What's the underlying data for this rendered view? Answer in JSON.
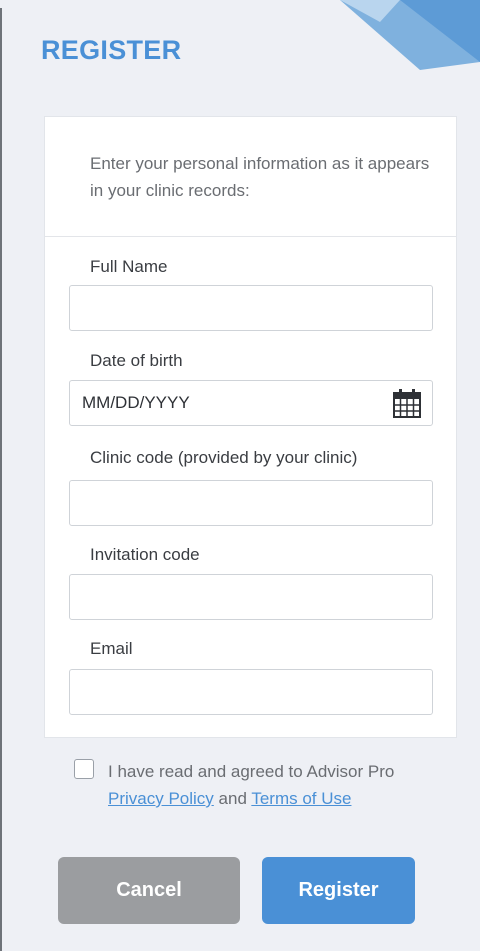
{
  "header": {
    "title": "REGISTER"
  },
  "intro": {
    "text": "Enter your personal information as it appears in your clinic records:"
  },
  "form": {
    "full_name": {
      "label": "Full Name",
      "value": "",
      "placeholder": ""
    },
    "dob": {
      "label": "Date of birth",
      "value": "",
      "placeholder": "MM/DD/YYYY"
    },
    "clinic_code": {
      "label": "Clinic code (provided by your clinic)",
      "value": "",
      "placeholder": ""
    },
    "invitation_code": {
      "label": "Invitation code",
      "value": "",
      "placeholder": ""
    },
    "email": {
      "label": "Email",
      "value": "",
      "placeholder": ""
    }
  },
  "agreement": {
    "checked": false,
    "prefix": "I have read and agreed to Advisor Pro ",
    "privacy_link": "Privacy Policy",
    "connector": " and ",
    "terms_link": "Terms of Use"
  },
  "buttons": {
    "cancel_label": "Cancel",
    "register_label": "Register"
  },
  "colors": {
    "accent": "#4a90d6",
    "cancel": "#9b9da0",
    "background": "#eef0f5"
  },
  "icons": {
    "date_picker": "calendar-icon"
  }
}
